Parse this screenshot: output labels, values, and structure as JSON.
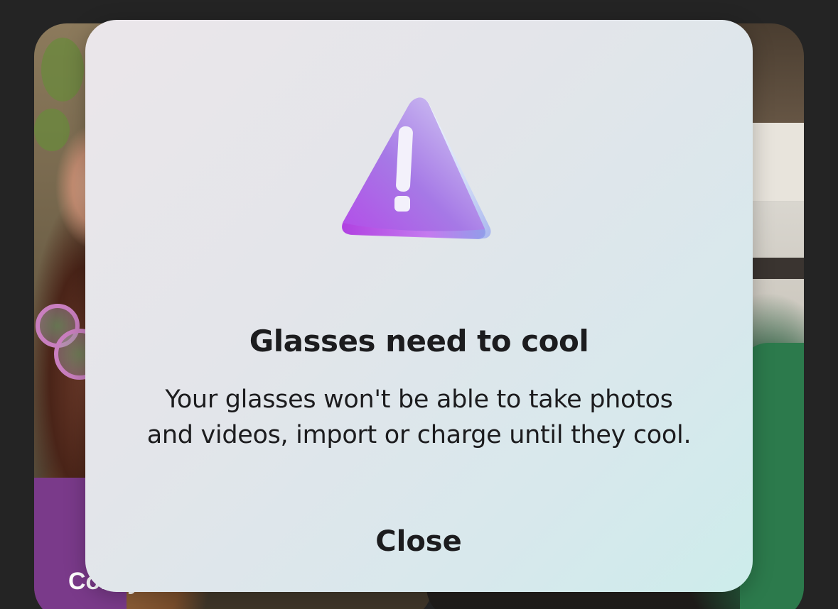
{
  "background": {
    "left_card": {
      "caption": "Co... y"
    },
    "right_card": {
      "caption": ""
    }
  },
  "dialog": {
    "icon": "warning-triangle-icon",
    "title": "Glasses need to cool",
    "body_lines": [
      "Your glasses won't be able to take photos",
      "and videos, import or charge until they cool."
    ],
    "close_label": "Close"
  },
  "colors": {
    "page_background": "#242424",
    "dialog_background_start": "#ebe6ea",
    "dialog_background_end": "#cdeceb",
    "text": "#1c1c1e",
    "icon_purple": "#a86be8",
    "icon_highlight": "#e9f0ff"
  }
}
